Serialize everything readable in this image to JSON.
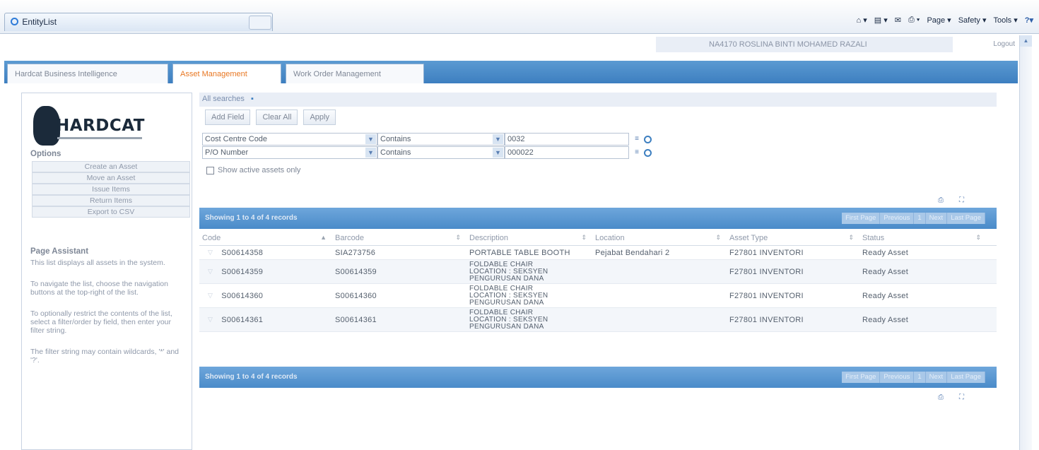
{
  "browser": {
    "tab_title": "EntityList",
    "commands": [
      "Page ▾",
      "Safety ▾",
      "Tools ▾"
    ]
  },
  "user": {
    "name": "NA4170 ROSLINA BINTI MOHAMED RAZALI",
    "logout": "Logout"
  },
  "tabs": [
    {
      "label": "Hardcat Business Intelligence",
      "active": false
    },
    {
      "label": "Asset Management",
      "active": true
    },
    {
      "label": "Work Order Management",
      "active": false
    }
  ],
  "logo": {
    "text": "HARDCAT"
  },
  "options": {
    "title": "Options",
    "items": [
      "Create an Asset",
      "Move an Asset",
      "Issue Items",
      "Return Items",
      "Export to CSV"
    ]
  },
  "page_assistant": {
    "title": "Page Assistant",
    "paragraphs": [
      "This list displays all assets in the system.",
      "To navigate the list, choose the navigation buttons at the top-right of the list.",
      "To optionally restrict the contents of the list, select a filter/order by field, then enter your filter string.",
      "The filter string may contain wildcards, '*' and '?'."
    ]
  },
  "search": {
    "header": "All searches",
    "buttons": [
      "Add Field",
      "Clear All",
      "Apply"
    ],
    "filters": [
      {
        "field": "Cost Centre Code",
        "operator": "Contains",
        "value": "0032"
      },
      {
        "field": "P/O Number",
        "operator": "Contains",
        "value": "000022"
      }
    ],
    "active_only_label": "Show active assets only"
  },
  "grid": {
    "showing": "Showing 1 to 4 of 4 records",
    "pager": [
      "First Page",
      "Previous",
      "1",
      "Next",
      "Last Page"
    ],
    "columns": [
      "Code",
      "Barcode",
      "Description",
      "Location",
      "Asset Type",
      "Status"
    ],
    "rows": [
      {
        "code": "S00614358",
        "barcode": "SIA273756",
        "description": [
          "PORTABLE TABLE BOOTH"
        ],
        "location": "Pejabat Bendahari 2",
        "asset_type": "F27801 INVENTORI",
        "status": "Ready Asset"
      },
      {
        "code": "S00614359",
        "barcode": "S00614359",
        "description": [
          "FOLDABLE CHAIR",
          "LOCATION : SEKSYEN",
          "PENGURUSAN DANA"
        ],
        "location": "",
        "asset_type": "F27801 INVENTORI",
        "status": "Ready Asset"
      },
      {
        "code": "S00614360",
        "barcode": "S00614360",
        "description": [
          "FOLDABLE CHAIR",
          "LOCATION : SEKSYEN",
          "PENGURUSAN DANA"
        ],
        "location": "",
        "asset_type": "F27801 INVENTORI",
        "status": "Ready Asset"
      },
      {
        "code": "S00614361",
        "barcode": "S00614361",
        "description": [
          "FOLDABLE CHAIR",
          "LOCATION : SEKSYEN",
          "PENGURUSAN DANA"
        ],
        "location": "",
        "asset_type": "F27801 INVENTORI",
        "status": "Ready Asset"
      }
    ]
  }
}
